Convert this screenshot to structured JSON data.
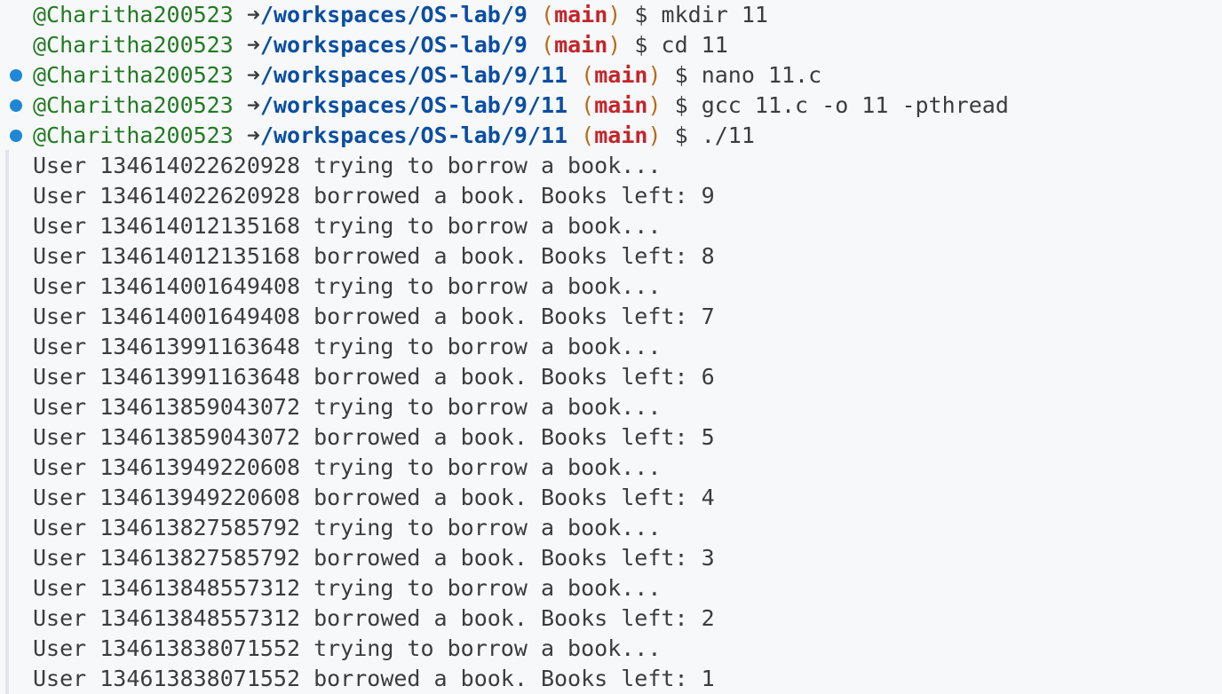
{
  "terminal": {
    "user": "@Charitha200523",
    "arrow": "➜",
    "branch": "main",
    "prompt_symbol": "$",
    "commands": [
      {
        "path": "/workspaces/OS-lab/9",
        "command": "mkdir 11",
        "has_dot": false
      },
      {
        "path": "/workspaces/OS-lab/9",
        "command": "cd 11",
        "has_dot": false
      },
      {
        "path": "/workspaces/OS-lab/9/11",
        "command": "nano 11.c",
        "has_dot": true
      },
      {
        "path": "/workspaces/OS-lab/9/11",
        "command": "gcc 11.c -o 11 -pthread",
        "has_dot": true
      },
      {
        "path": "/workspaces/OS-lab/9/11",
        "command": "./11",
        "has_dot": true
      }
    ],
    "output": [
      "User 134614022620928 trying to borrow a book...",
      "User 134614022620928 borrowed a book. Books left: 9",
      "User 134614012135168 trying to borrow a book...",
      "User 134614012135168 borrowed a book. Books left: 8",
      "User 134614001649408 trying to borrow a book...",
      "User 134614001649408 borrowed a book. Books left: 7",
      "User 134613991163648 trying to borrow a book...",
      "User 134613991163648 borrowed a book. Books left: 6",
      "User 134613859043072 trying to borrow a book...",
      "User 134613859043072 borrowed a book. Books left: 5",
      "User 134613949220608 trying to borrow a book...",
      "User 134613949220608 borrowed a book. Books left: 4",
      "User 134613827585792 trying to borrow a book...",
      "User 134613827585792 borrowed a book. Books left: 3",
      "User 134613848557312 trying to borrow a book...",
      "User 134613848557312 borrowed a book. Books left: 2",
      "User 134613838071552 trying to borrow a book...",
      "User 134613838071552 borrowed a book. Books left: 1"
    ],
    "colors": {
      "background": "#f7f8fa",
      "user": "#237a23",
      "path": "#0a4ea0",
      "branch": "#c4252a",
      "paren": "#bb6a1a",
      "text": "#3c3c3c",
      "decoration_dot": "#1e88d6"
    }
  }
}
